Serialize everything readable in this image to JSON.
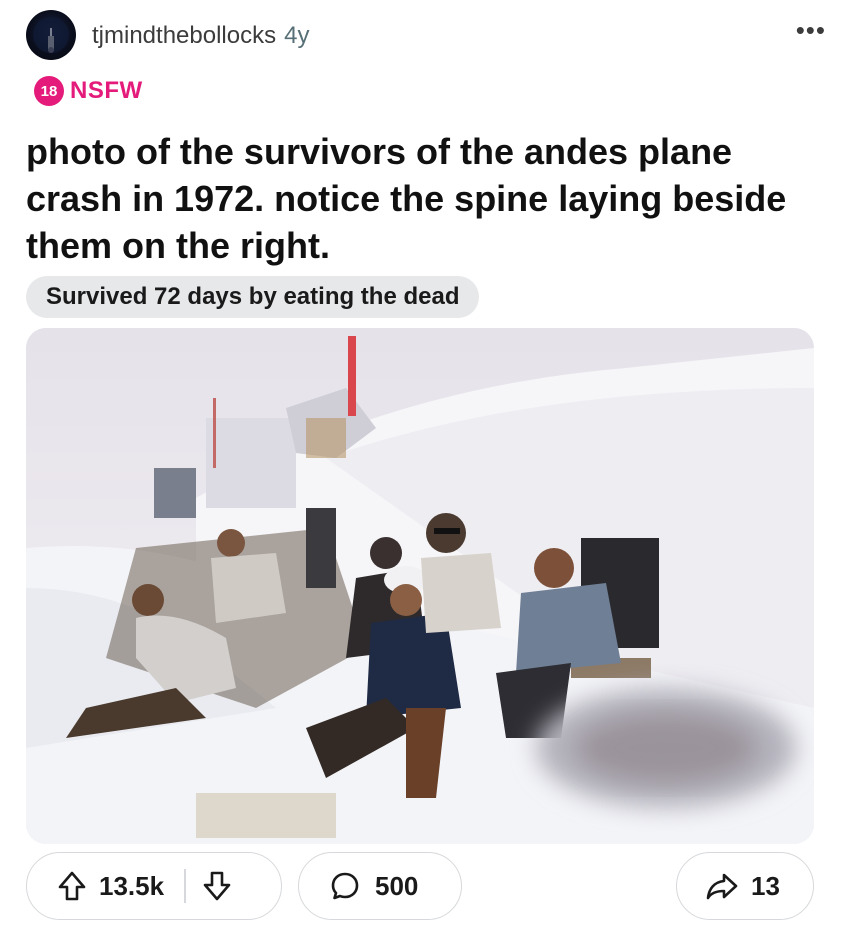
{
  "post": {
    "username": "tjmindthebollocks",
    "age": "4y",
    "more_label": "•••",
    "nsfw_badge": "18",
    "nsfw_label": "NSFW",
    "title": "photo of the survivors of the andes plane crash in 1972. notice the spine laying beside them on the right.",
    "flair": "Survived 72 days by eating the dead"
  },
  "actions": {
    "upvote_count": "13.5k",
    "comment_count": "500",
    "share_count": "13"
  },
  "icons": {
    "upvote": "arrow-up-icon",
    "downvote": "arrow-down-icon",
    "comment": "speech-bubble-icon",
    "share": "share-arrow-icon",
    "more": "ellipsis-icon"
  },
  "colors": {
    "nsfw": "#e41b7a",
    "text": "#1a1a1b",
    "flair_bg": "#e6e8ea",
    "pill_border": "#d6d8db"
  }
}
